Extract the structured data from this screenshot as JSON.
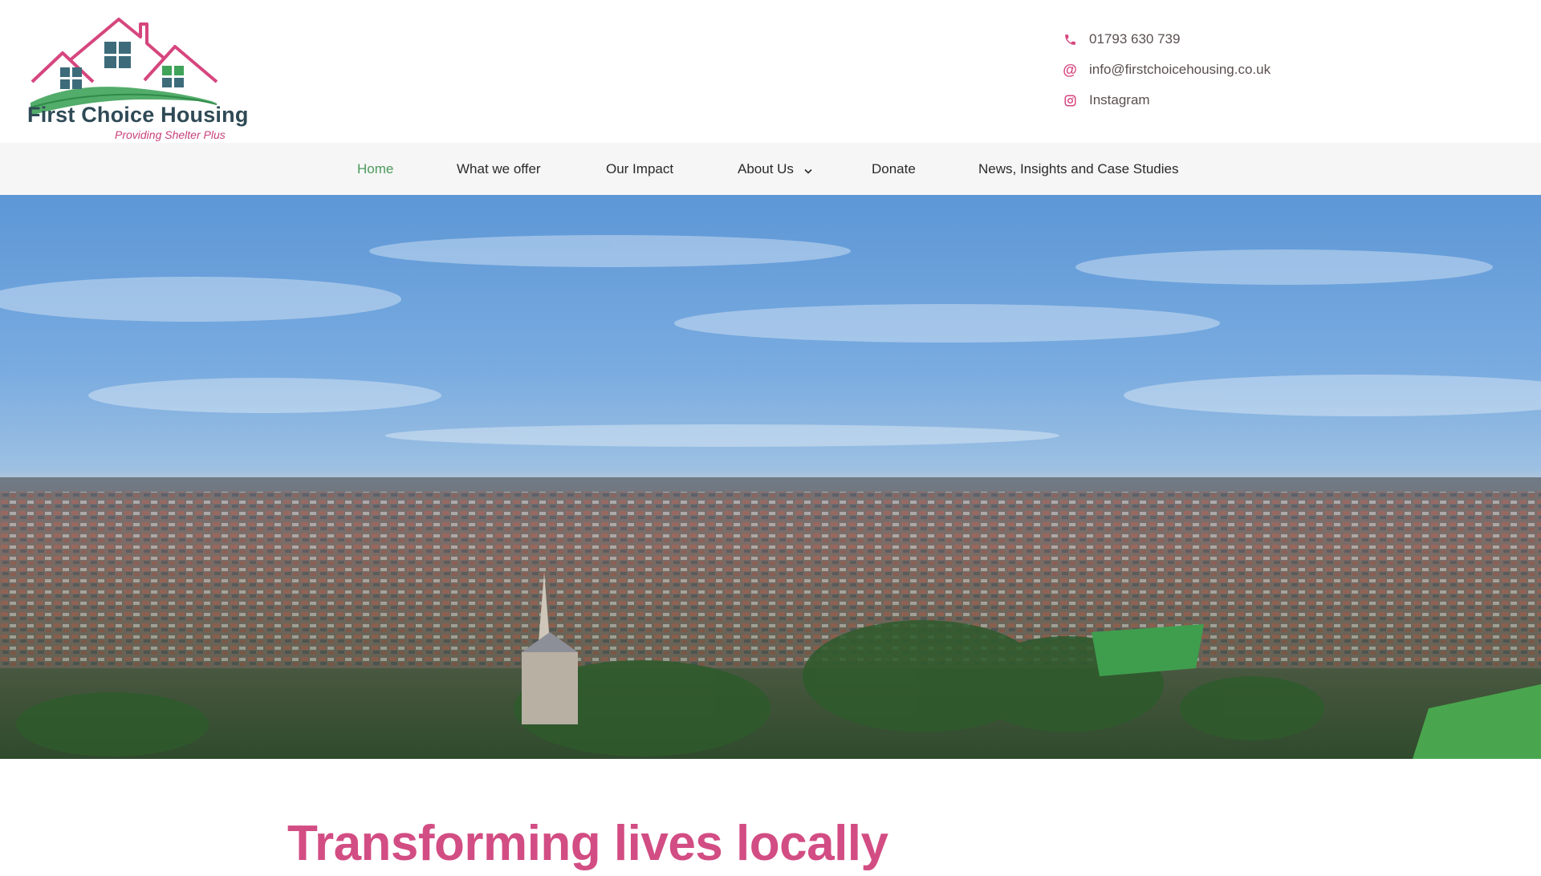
{
  "brand": {
    "name": "First Choice Housing",
    "tagline": "Providing Shelter Plus",
    "logo_icon": "house-roofs-icon"
  },
  "contact": {
    "phone": {
      "icon": "phone-icon",
      "label": "01793 630 739"
    },
    "email": {
      "icon": "at-sign-icon",
      "label": "info@firstchoicehousing.co.uk"
    },
    "instagram": {
      "icon": "instagram-icon",
      "label": "Instagram"
    }
  },
  "nav": {
    "items": [
      {
        "label": "Home",
        "active": true
      },
      {
        "label": "What we offer"
      },
      {
        "label": "Our Impact"
      },
      {
        "label": "About Us",
        "has_dropdown": true
      },
      {
        "label": "Donate"
      },
      {
        "label": "News, Insights and Case Studies"
      }
    ]
  },
  "hero": {
    "image": "aerial town panorama with church spire"
  },
  "main": {
    "headline": "Transforming lives locally"
  },
  "colors": {
    "accent_pink": "#d24d83",
    "active_green": "#4c9a5e",
    "logo_teal": "#2f4a56",
    "nav_bg": "#f6f6f6"
  }
}
